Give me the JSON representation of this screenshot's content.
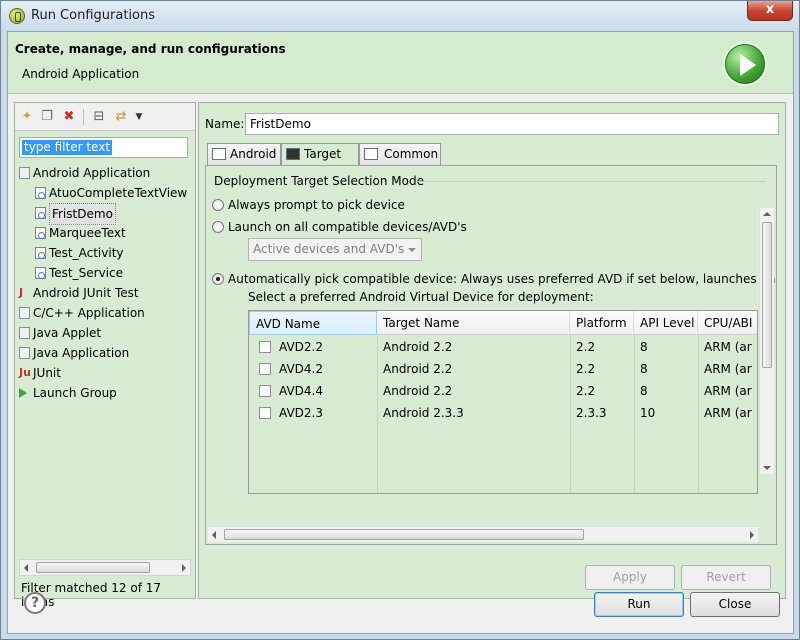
{
  "window": {
    "title": "Run Configurations",
    "close_glyph": "x"
  },
  "header": {
    "title": "Create, manage, and run configurations",
    "subtitle": "Android Application",
    "icon": "run-icon"
  },
  "left": {
    "toolbar_icons": [
      "new-config-icon",
      "duplicate-icon",
      "delete-icon",
      "collapse-all-icon",
      "filter-icon",
      "dropdown-icon"
    ],
    "filter_placeholder": "type filter text",
    "tree": [
      {
        "label": "Android Application",
        "level": 0,
        "icon": "android-app-icon"
      },
      {
        "label": "AtuoCompleteTextView",
        "level": 1,
        "icon": "config-icon"
      },
      {
        "label": "FristDemo",
        "level": 1,
        "icon": "config-icon",
        "selected": true
      },
      {
        "label": "MarqueeText",
        "level": 1,
        "icon": "config-icon"
      },
      {
        "label": "Test_Activity",
        "level": 1,
        "icon": "config-icon"
      },
      {
        "label": "Test_Service",
        "level": 1,
        "icon": "config-icon"
      },
      {
        "label": "Android JUnit Test",
        "level": 0,
        "icon": "junit-android-icon"
      },
      {
        "label": "C/C++ Application",
        "level": 0,
        "icon": "cpp-app-icon"
      },
      {
        "label": "Java Applet",
        "level": 0,
        "icon": "applet-icon"
      },
      {
        "label": "Java Application",
        "level": 0,
        "icon": "java-app-icon"
      },
      {
        "label": "JUnit",
        "level": 0,
        "icon": "junit-icon"
      },
      {
        "label": "Launch Group",
        "level": 0,
        "icon": "launch-group-icon"
      }
    ],
    "status": "Filter matched 12 of 17 items"
  },
  "right": {
    "name_label": "Name:",
    "name_value": "FristDemo",
    "tabs": [
      {
        "label": "Android",
        "active": false
      },
      {
        "label": "Target",
        "active": true
      },
      {
        "label": "Common",
        "active": false
      }
    ],
    "target": {
      "group_title": "Deployment Target Selection Mode",
      "radio_always": "Always prompt to pick device",
      "radio_launch_all": "Launch on all compatible devices/AVD's",
      "combo_value": "Active devices and AVD's",
      "radio_auto": "Automatically pick compatible device: Always uses preferred AVD if set below, launches on",
      "select_label": "Select a preferred Android Virtual Device for deployment:",
      "columns": [
        "AVD Name",
        "Target Name",
        "Platform",
        "API Level",
        "CPU/ABI"
      ],
      "rows": [
        {
          "name": "AVD2.2",
          "target": "Android 2.2",
          "platform": "2.2",
          "api": "8",
          "cpu": "ARM (ar"
        },
        {
          "name": "AVD4.2",
          "target": "Android 2.2",
          "platform": "2.2",
          "api": "8",
          "cpu": "ARM (ar"
        },
        {
          "name": "AVD4.4",
          "target": "Android 2.2",
          "platform": "2.2",
          "api": "8",
          "cpu": "ARM (ar"
        },
        {
          "name": "AVD2.3",
          "target": "Android 2.3.3",
          "platform": "2.3.3",
          "api": "10",
          "cpu": "ARM (ar"
        }
      ]
    },
    "apply": "Apply",
    "revert": "Revert"
  },
  "footer": {
    "help_glyph": "?",
    "run": "Run",
    "close": "Close"
  }
}
